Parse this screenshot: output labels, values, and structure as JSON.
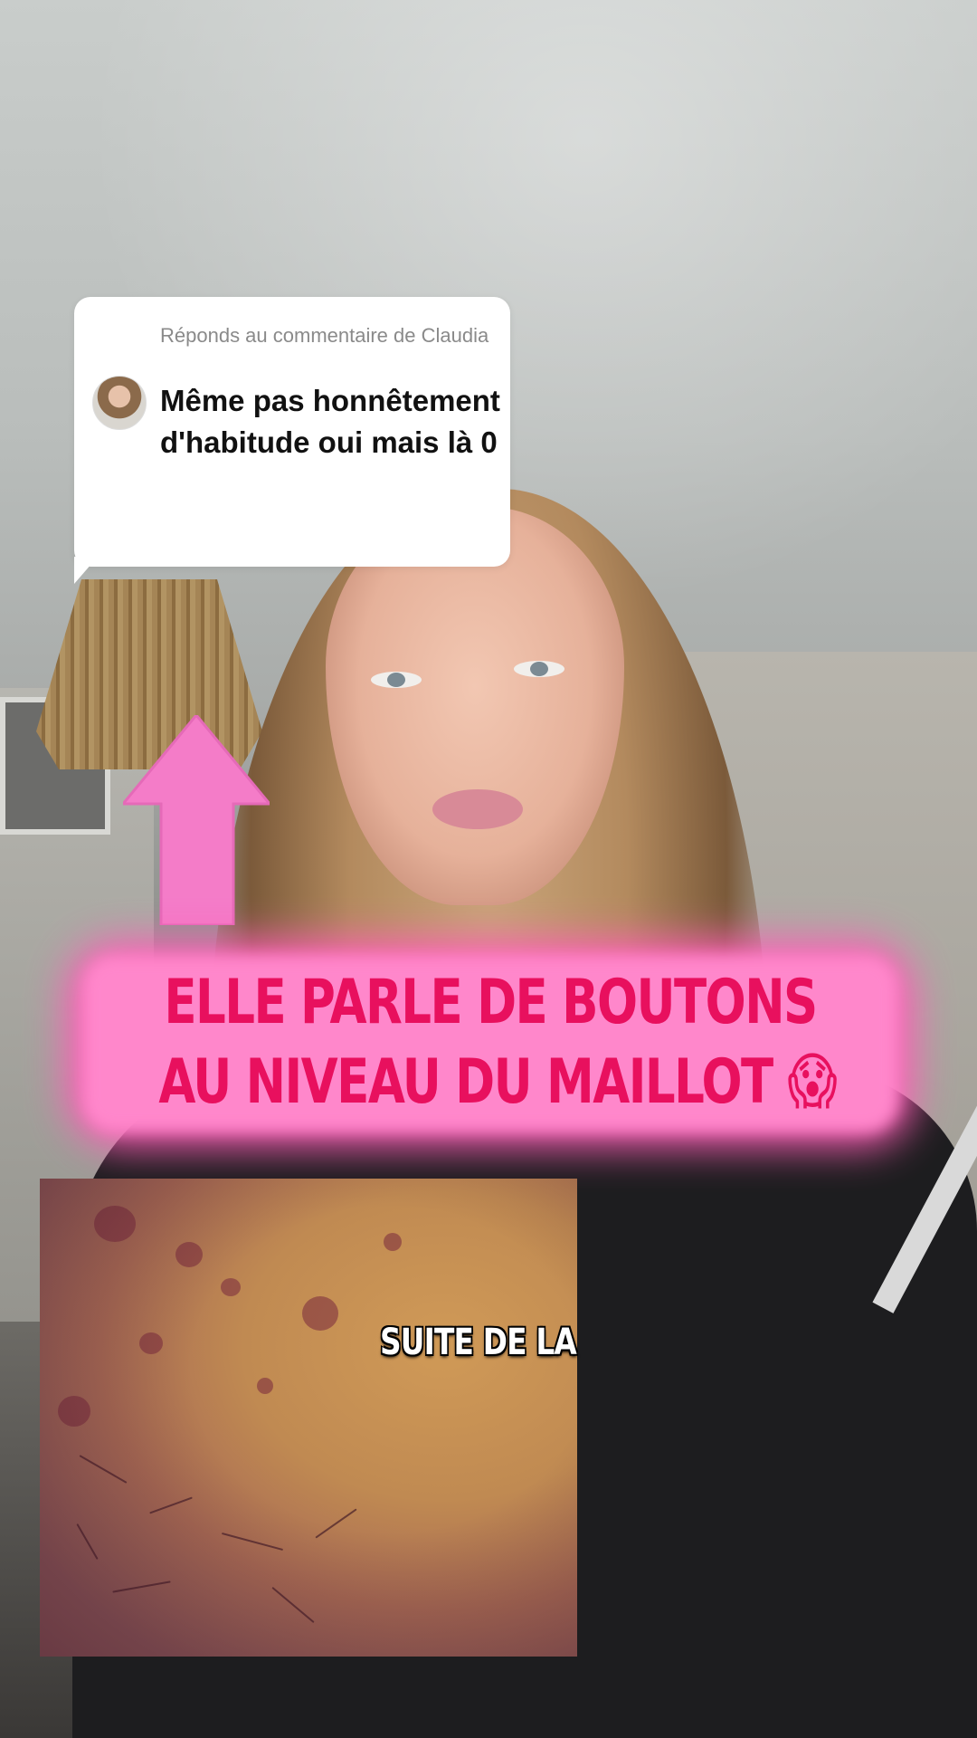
{
  "comment_reply": {
    "label": "Réponds au commentaire de Claudia",
    "text": "Même pas honnêtement d'habitude oui mais là 0",
    "avatar_icon": "user-avatar-icon"
  },
  "caption": {
    "line1": "Elle parle de boutons",
    "line2": "au niveau du maillot",
    "emoji": "😱",
    "text_color": "#e8105e",
    "glow_color": "#ff5fb8"
  },
  "arrow": {
    "icon": "up-arrow-icon",
    "color": "#f47cc8"
  },
  "subtitle": {
    "text": "SUITE DE LA"
  },
  "inset_photo": {
    "icon": "skin-closeup-image"
  }
}
